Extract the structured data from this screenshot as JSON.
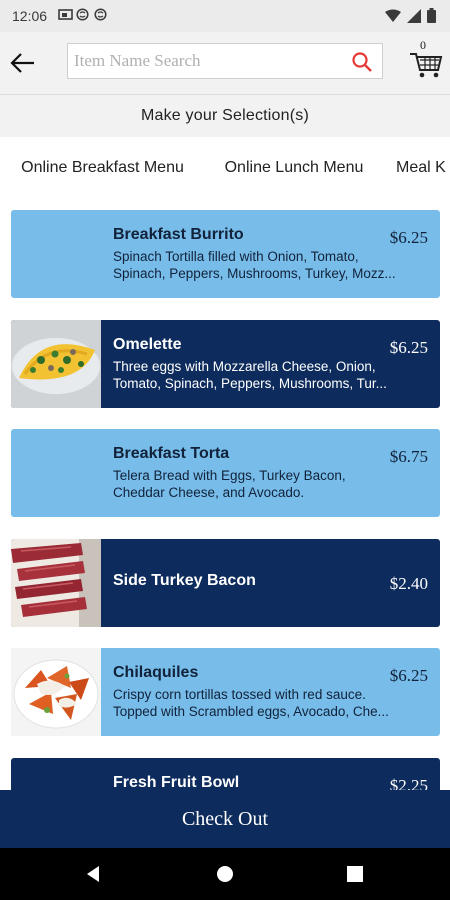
{
  "status": {
    "time": "12:06"
  },
  "header": {
    "search_placeholder": "Item Name Search",
    "cart_count": "0"
  },
  "selection_title": "Make your Selection(s)",
  "tabs": [
    {
      "label": "Online Breakfast Menu"
    },
    {
      "label": "Online Lunch Menu"
    },
    {
      "label": "Meal K"
    }
  ],
  "items": [
    {
      "name": "Breakfast Burrito",
      "price": "$6.25",
      "desc_lines": [
        "Spinach Tortilla filled with Onion, Tomato,",
        "Spinach, Peppers, Mushrooms, Turkey, Mozz..."
      ],
      "style": "light"
    },
    {
      "name": "Omelette",
      "price": "$6.25",
      "desc_lines": [
        "Three eggs with Mozzarella Cheese, Onion,",
        "Tomato, Spinach, Peppers, Mushrooms, Tur..."
      ],
      "style": "dark"
    },
    {
      "name": "Breakfast Torta",
      "price": "$6.75",
      "desc_lines": [
        "Telera Bread with Eggs, Turkey Bacon,",
        "Cheddar Cheese, and Avocado."
      ],
      "style": "light"
    },
    {
      "name": "Side Turkey Bacon",
      "price": "$2.40",
      "desc_lines": [],
      "style": "dark"
    },
    {
      "name": "Chilaquiles",
      "price": "$6.25",
      "desc_lines": [
        "Crispy corn tortillas tossed with red sauce.",
        "Topped with Scrambled eggs, Avocado, Che..."
      ],
      "style": "light"
    },
    {
      "name": "Fresh Fruit Bowl",
      "price": "$2.25",
      "desc_lines": [],
      "style": "dark"
    }
  ],
  "checkout_label": "Check Out",
  "colors": {
    "primary_dark": "#0d2b5c",
    "item_light": "#78bdea",
    "search_icon": "#e53935"
  }
}
